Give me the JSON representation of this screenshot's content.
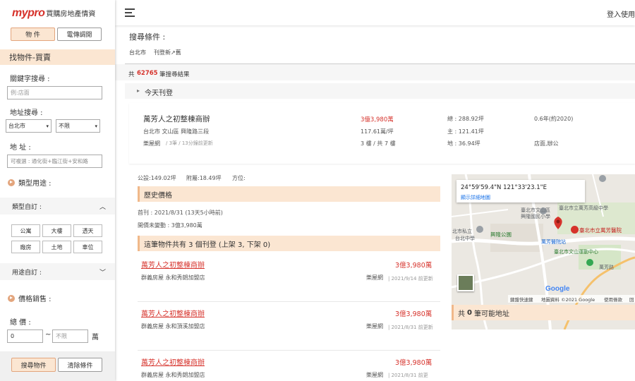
{
  "sidebar": {
    "logo_brand": "mypro",
    "logo_sub": "買購房地產情資",
    "tab_property": "物 件",
    "tab_telemarketing": "電傳調閱",
    "section_title": "找物件-買賣",
    "keyword_label": "關鍵字搜尋 :",
    "keyword_placeholder": "例:店面",
    "address_label": "地址搜尋 :",
    "city_value": "台北市",
    "district_value": "不限",
    "addr_label": "地 址 :",
    "addr_placeholder": "可複選 : 通化街+臨江街+安和路",
    "type_label": "類型用途 :",
    "type_custom_label": "類型自訂 :",
    "type_tags": [
      "公寓",
      "大樓",
      "透天",
      "廠房",
      "土地",
      "車位"
    ],
    "use_custom_label": "用途自訂 :",
    "price_label": "價格銷售 :",
    "total_label": "總 價 :",
    "price_min": "0",
    "price_tilde": "~",
    "price_max_placeholder": "不限",
    "price_unit": "萬",
    "search_button": "搜尋物件",
    "clear_button": "清除條件"
  },
  "topbar": {
    "login": "登入使用"
  },
  "main": {
    "search_condition_label": "搜尋條件 :",
    "breadcrumb_city": "台北市",
    "breadcrumb_newest": "刊登新↗舊",
    "result_prefix": "共",
    "result_count": "62765",
    "result_suffix": "筆搜尋結果",
    "today_label": "今天刊登",
    "listing": {
      "title": "萬芳人之初整棟商辦",
      "address": "台北市 文山區 興隆路三段",
      "source": "樂屋網",
      "source_meta": "/ 3筆 / 13分鐘前更新",
      "price": "3億3,980萬",
      "unit_price": "117.61萬/坪",
      "floors": "3 樓 / 共 7 樓",
      "total_area": "總 : 288.92坪",
      "main_area": "主 : 121.41坪",
      "land_area": "地 : 36.94坪",
      "age": "0.6年(約2020)",
      "use": "店面,辦公"
    },
    "detail": {
      "public_area": "公設:149.02坪",
      "attached_area": "附屬:18.49坪",
      "orientation": "方位:",
      "history_title": "歷史價格",
      "first_listed": "首刊 : 2021/8/31 (13天5小時前)",
      "price_change": "開價未變動 : 3億3,980萬",
      "sources_title": "這筆物件共有 3 個刊登 (上架 3, 下架 0)"
    },
    "sources": [
      {
        "title": "萬芳人之初整棟商辦",
        "agent": "群義房屋 永和秀朗加盟店",
        "price": "3億3,980萬",
        "site": "樂屋網",
        "date": "2021/9/14 前更新"
      },
      {
        "title": "萬芳人之初整棟商辦",
        "agent": "群義房屋 永和頂溪加盟店",
        "price": "3億3,980萬",
        "site": "樂屋網",
        "date": "2021/8/31 前更新"
      },
      {
        "title": "萬芳人之初整棟商辦",
        "agent": "群義房屋 永和秀朗加盟店",
        "price": "3億3,980萬",
        "site": "樂屋網",
        "date": "2021/8/31 前更"
      }
    ],
    "map": {
      "coords": "24°59'59.4\"N 121°33'23.1\"E",
      "view_larger": "顯示詳細地圖",
      "labels": {
        "school1": "臺北市立萬芳高級中學",
        "school2": "臺北市文山區",
        "school2b": "興隆國民小學",
        "school3": "北市私立",
        "school3b": "台北中學",
        "park": "興隆公園",
        "hospital": "臺北市立萬芳醫院",
        "station": "萬芳醫院站",
        "sports": "臺北市文山運動中心",
        "road": "萬芳路"
      },
      "google": "Google",
      "shortcuts": "鍵盤快速鍵",
      "map_data": "地圖資料 ©2021 Google",
      "terms": "使用條款",
      "report": "回"
    },
    "possible_addr_prefix": "共",
    "possible_addr_count": "0",
    "possible_addr_suffix": "筆可能地址"
  }
}
